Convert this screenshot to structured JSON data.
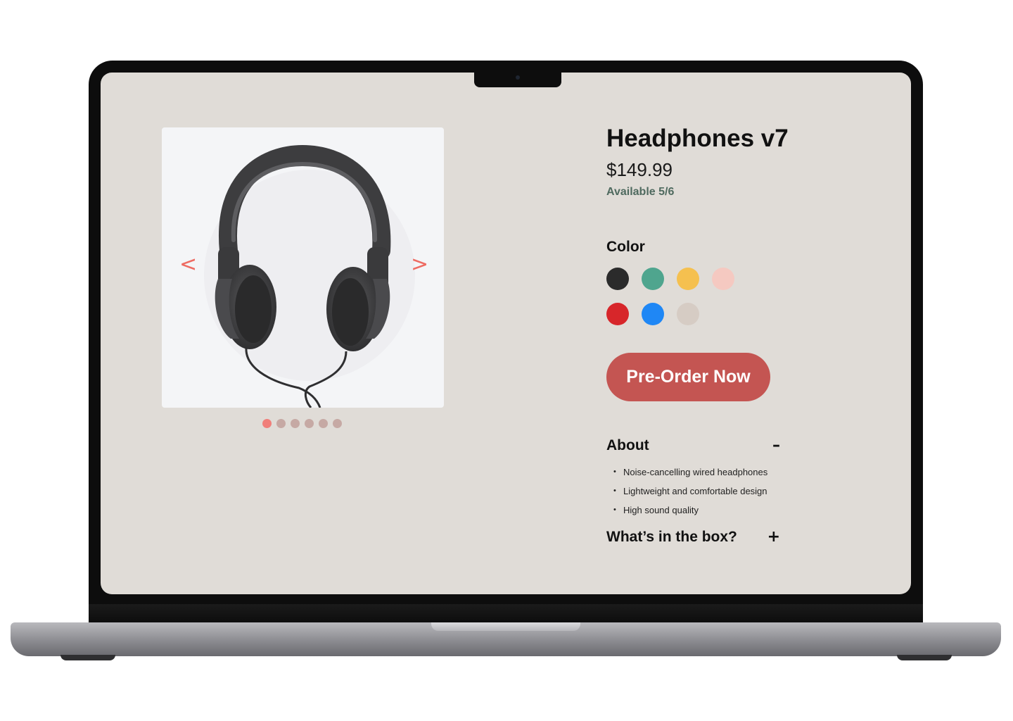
{
  "product": {
    "title": "Headphones v7",
    "price": "$149.99",
    "availability": "Available 5/6"
  },
  "gallery": {
    "prev_label": "<",
    "next_label": ">",
    "slide_count": 6,
    "active_index": 0,
    "image_icon": "headphones-photo"
  },
  "color": {
    "label": "Color",
    "swatches": [
      "#2b2b2b",
      "#4fa58e",
      "#f5c04f",
      "#f5c9c1",
      "#d7262a",
      "#1f87f5",
      "#d6ccc4"
    ]
  },
  "cta": {
    "label": "Pre-Order Now",
    "color": "#c45552"
  },
  "about": {
    "title": "About",
    "toggle": "–",
    "items": [
      "Noise-cancelling wired headphones",
      "Lightweight and comfortable design",
      "High sound quality"
    ]
  },
  "box": {
    "title": "What’s in the box?",
    "toggle": "+"
  },
  "colors": {
    "screen_bg": "#e0dcd7",
    "accent": "#ee6b62"
  }
}
